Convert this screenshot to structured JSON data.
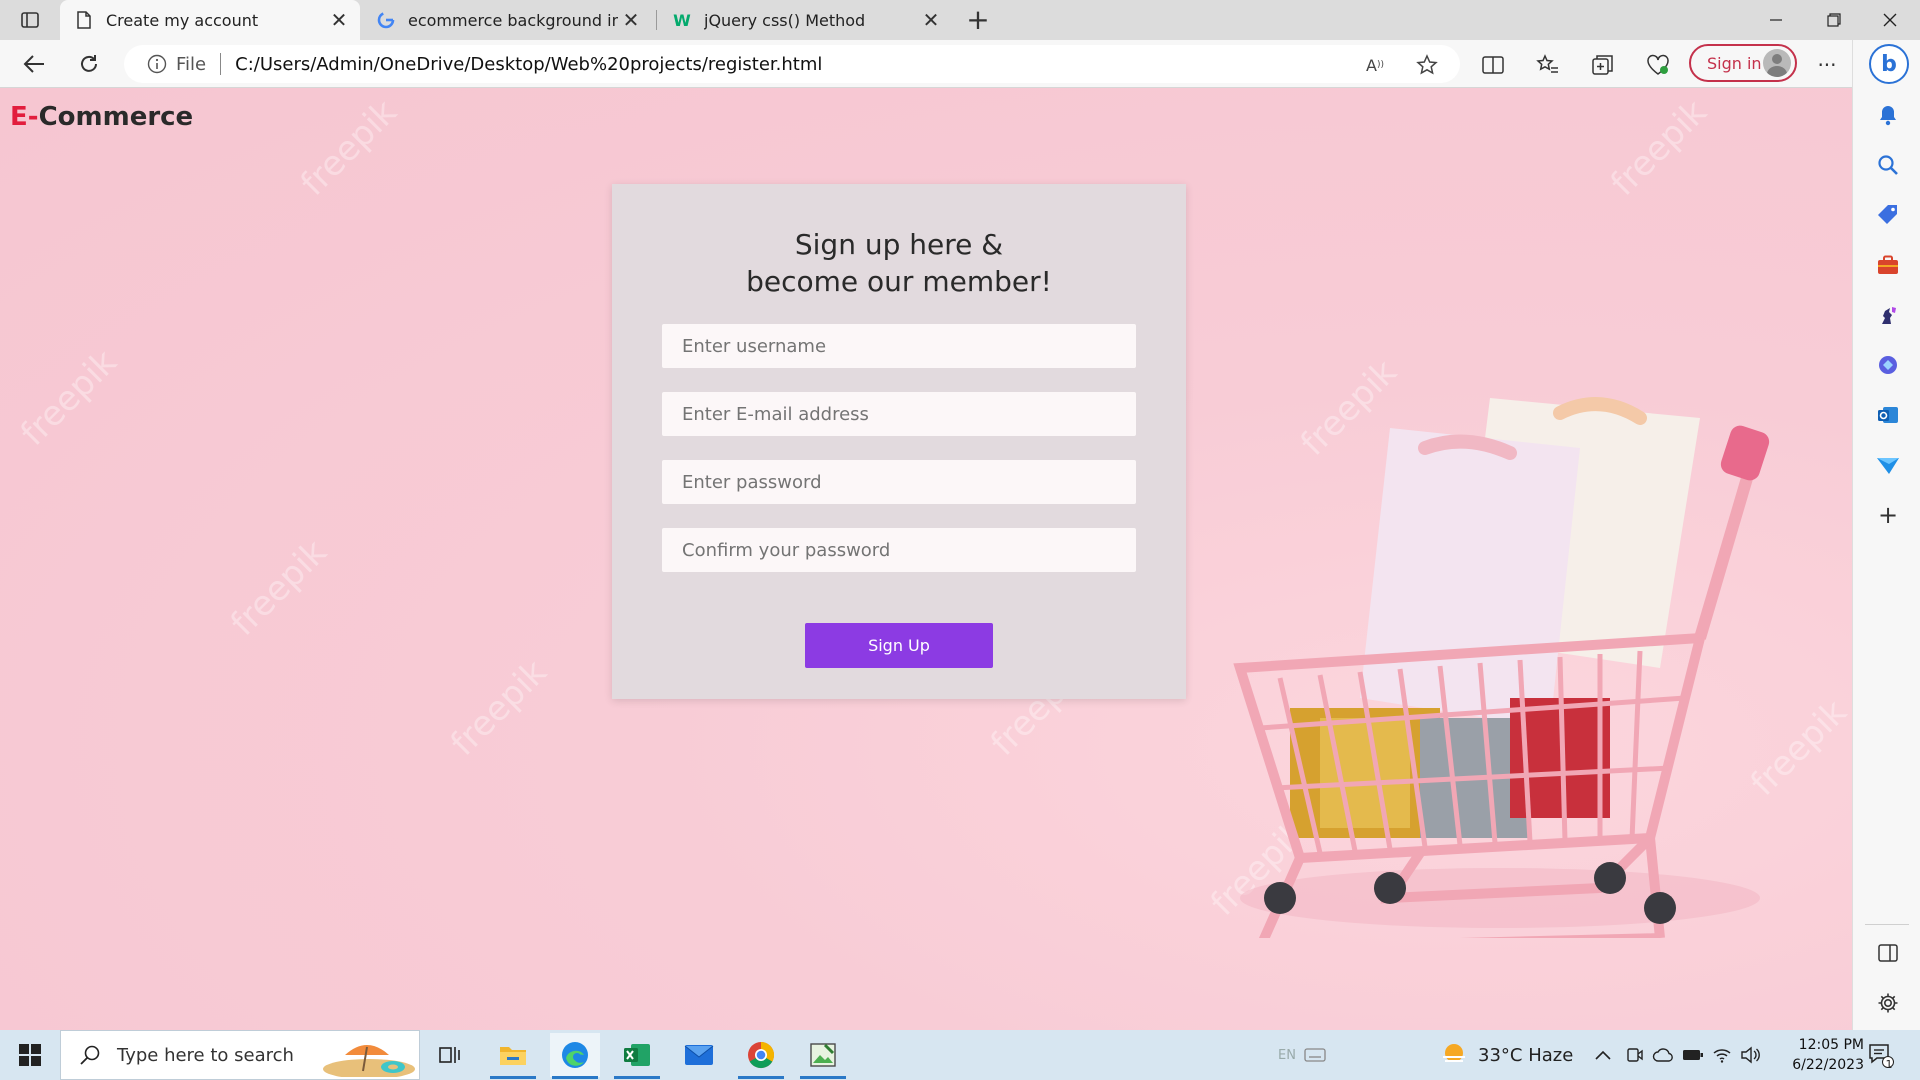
{
  "browser": {
    "tabs": [
      {
        "title": "Create my account",
        "icon": "page-icon"
      },
      {
        "title": "ecommerce background image li",
        "icon": "google-icon"
      },
      {
        "title": "jQuery css() Method",
        "icon": "w3schools-icon"
      }
    ],
    "address": {
      "scheme_label": "File",
      "url": "C:/Users/Admin/OneDrive/Desktop/Web%20projects/register.html"
    },
    "signin_label": "Sign in",
    "bing_label": "b"
  },
  "page": {
    "logo_accent": "E-",
    "logo_rest": "Commerce",
    "watermark": "freepik",
    "form": {
      "title_line1": "Sign up here &",
      "title_line2": "become our member!",
      "username_placeholder": "Enter username",
      "email_placeholder": "Enter E-mail address",
      "password_placeholder": "Enter password",
      "confirm_placeholder": "Confirm your password",
      "submit_label": "Sign Up"
    },
    "colors": {
      "accent": "#8c3be3",
      "logo_accent": "#e21d3d",
      "background": "#f7c9d3",
      "card": "#e2dade"
    }
  },
  "taskbar": {
    "search_placeholder": "Type here to search",
    "weather": "33°C  Haze",
    "lang": "EN",
    "time": "12:05 PM",
    "date": "6/22/2023",
    "notification_count": "1"
  }
}
